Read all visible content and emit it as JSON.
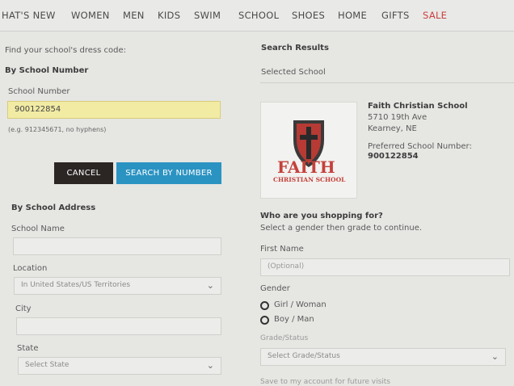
{
  "nav": [
    "HAT'S NEW",
    "WOMEN",
    "MEN",
    "KIDS",
    "SWIM",
    "SCHOOL",
    "SHOES",
    "HOME",
    "GIFTS",
    "SALE"
  ],
  "left": {
    "heading": "Find your school's dress code:",
    "by_number": "By School Number",
    "school_number_label": "School Number",
    "school_number_value": "900122854",
    "hint": "(e.g. 912345671, no hyphens)",
    "cancel": "CANCEL",
    "search_by_number": "SEARCH BY NUMBER",
    "by_address": "By School Address",
    "school_name_label": "School Name",
    "location_label": "Location",
    "location_value": "In United States/US Territories",
    "city_label": "City",
    "state_label": "State",
    "state_value": "Select State"
  },
  "right": {
    "search_results": "Search Results",
    "selected_school": "Selected School",
    "logo_word": "FAITH",
    "logo_sub": "CHRISTIAN SCHOOL",
    "school_name": "Faith Christian School",
    "address1": "5710 19th Ave",
    "address2": "Kearney, NE",
    "preferred_label": "Preferred School Number:",
    "preferred_value": "900122854",
    "who_heading": "Who are you shopping for?",
    "who_sub": "Select a gender then grade to continue.",
    "first_name_label": "First Name",
    "first_name_placeholder": "(Optional)",
    "gender_label": "Gender",
    "gender_options": [
      "Girl / Woman",
      "Boy / Man"
    ],
    "grade_label": "Grade/Status",
    "grade_value": "Select Grade/Status",
    "save_text": "Save to my account for future visits"
  }
}
